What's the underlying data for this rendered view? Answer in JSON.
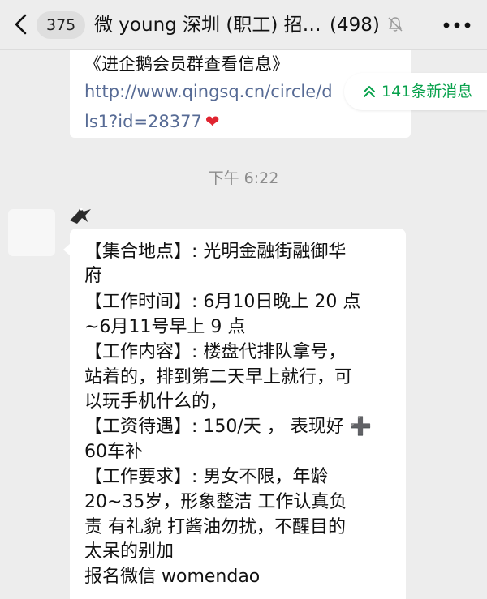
{
  "header": {
    "unread_count": "375",
    "title": "微 young 深圳 (职工) 招…",
    "member_count": "(498)"
  },
  "prev_message": {
    "text": "《进企鹅会员群查看信息》",
    "link_line1": "http://www.qingsq.cn/circle/d",
    "link_line2": "ls1?id=28377",
    "emoji": "❤"
  },
  "new_messages": {
    "label": "141条新消息"
  },
  "timestamp": "下午 6:22",
  "message_lines": [
    "【集合地点】: 光明金融街融御华",
    "府",
    "【工作时间】: 6月10日晚上 20 点",
    "~6月11号早上 9 点",
    "【工作内容】: 楼盘代排队拿号，",
    "站着的，排到第二天早上就行，可",
    "以玩手机什么的，",
    "【工资待遇】: 150/天 ， 表现好",
    "60车补",
    "【工作要求】: 男女不限，年龄",
    "20~35岁，形象整洁 工作认真负",
    "责 有礼貌 打酱油勿扰，不醒目的",
    "太呆的别加",
    "报名微信 womendao"
  ],
  "plus_symbol": "➕",
  "colors": {
    "background": "#ededed",
    "bubble": "#ffffff",
    "link": "#576b95",
    "new_message_green": "#07a14b",
    "timestamp_gray": "#8c8c8c"
  },
  "icons": [
    "back-chevron-icon",
    "mute-bell-icon",
    "more-dots-icon",
    "double-chevron-up-icon",
    "eagle-avatar-icon",
    "heart-icon",
    "plus-icon"
  ]
}
